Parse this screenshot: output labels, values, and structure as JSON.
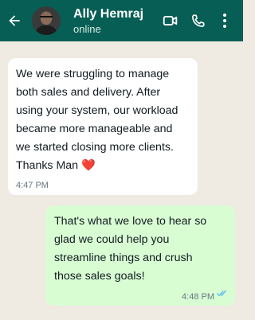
{
  "header": {
    "contact_name": "Ally Hemraj",
    "status": "online",
    "icons": [
      "back-arrow-icon",
      "avatar",
      "video-call-icon",
      "phone-icon",
      "more-vert-icon"
    ]
  },
  "messages": [
    {
      "direction": "incoming",
      "text": "We were struggling to manage\nboth sales and delivery. After\nusing your system, our workload\nbecame more manageable and\nwe started closing more clients.\nThanks Man ",
      "emoji": "❤️",
      "time": "4:47 PM"
    },
    {
      "direction": "outgoing",
      "text": "That's what we love to hear so\nglad we could help you\nstreamline things and crush\nthose sales goals!",
      "time": "4:48 PM",
      "read": true
    }
  ],
  "colors": {
    "header_bg": "#075e54",
    "chat_bg": "#efeae2",
    "incoming_bubble": "#ffffff",
    "outgoing_bubble": "#d9fdd3",
    "read_ticks": "#53bdeb"
  }
}
